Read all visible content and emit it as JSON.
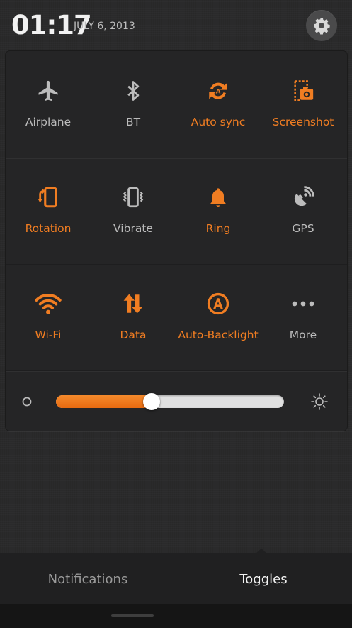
{
  "status": {
    "time": "01:17",
    "date": "JULY 6, 2013",
    "settings_icon": "gear-icon"
  },
  "toggles": [
    {
      "label": "Airplane",
      "icon": "airplane-icon",
      "on": false
    },
    {
      "label": "BT",
      "icon": "bluetooth-icon",
      "on": false
    },
    {
      "label": "Auto sync",
      "icon": "auto-sync-icon",
      "on": true
    },
    {
      "label": "Screenshot",
      "icon": "screenshot-icon",
      "on": true
    },
    {
      "label": "Rotation",
      "icon": "rotation-icon",
      "on": true
    },
    {
      "label": "Vibrate",
      "icon": "vibrate-icon",
      "on": false
    },
    {
      "label": "Ring",
      "icon": "bell-icon",
      "on": true
    },
    {
      "label": "GPS",
      "icon": "gps-icon",
      "on": false
    },
    {
      "label": "Wi-Fi",
      "icon": "wifi-icon",
      "on": true
    },
    {
      "label": "Data",
      "icon": "data-icon",
      "on": true
    },
    {
      "label": "Auto-Backlight",
      "icon": "auto-backlight-icon",
      "on": true
    },
    {
      "label": "More",
      "icon": "more-icon",
      "on": false
    }
  ],
  "brightness": {
    "level_percent": 42,
    "low_icon": "brightness-low-icon",
    "high_icon": "brightness-high-icon"
  },
  "tabs": {
    "notifications": "Notifications",
    "toggles": "Toggles",
    "active": "toggles"
  },
  "colors": {
    "accent": "#f07d22",
    "icon_off": "#bcbcbc",
    "panel": "#252526"
  }
}
